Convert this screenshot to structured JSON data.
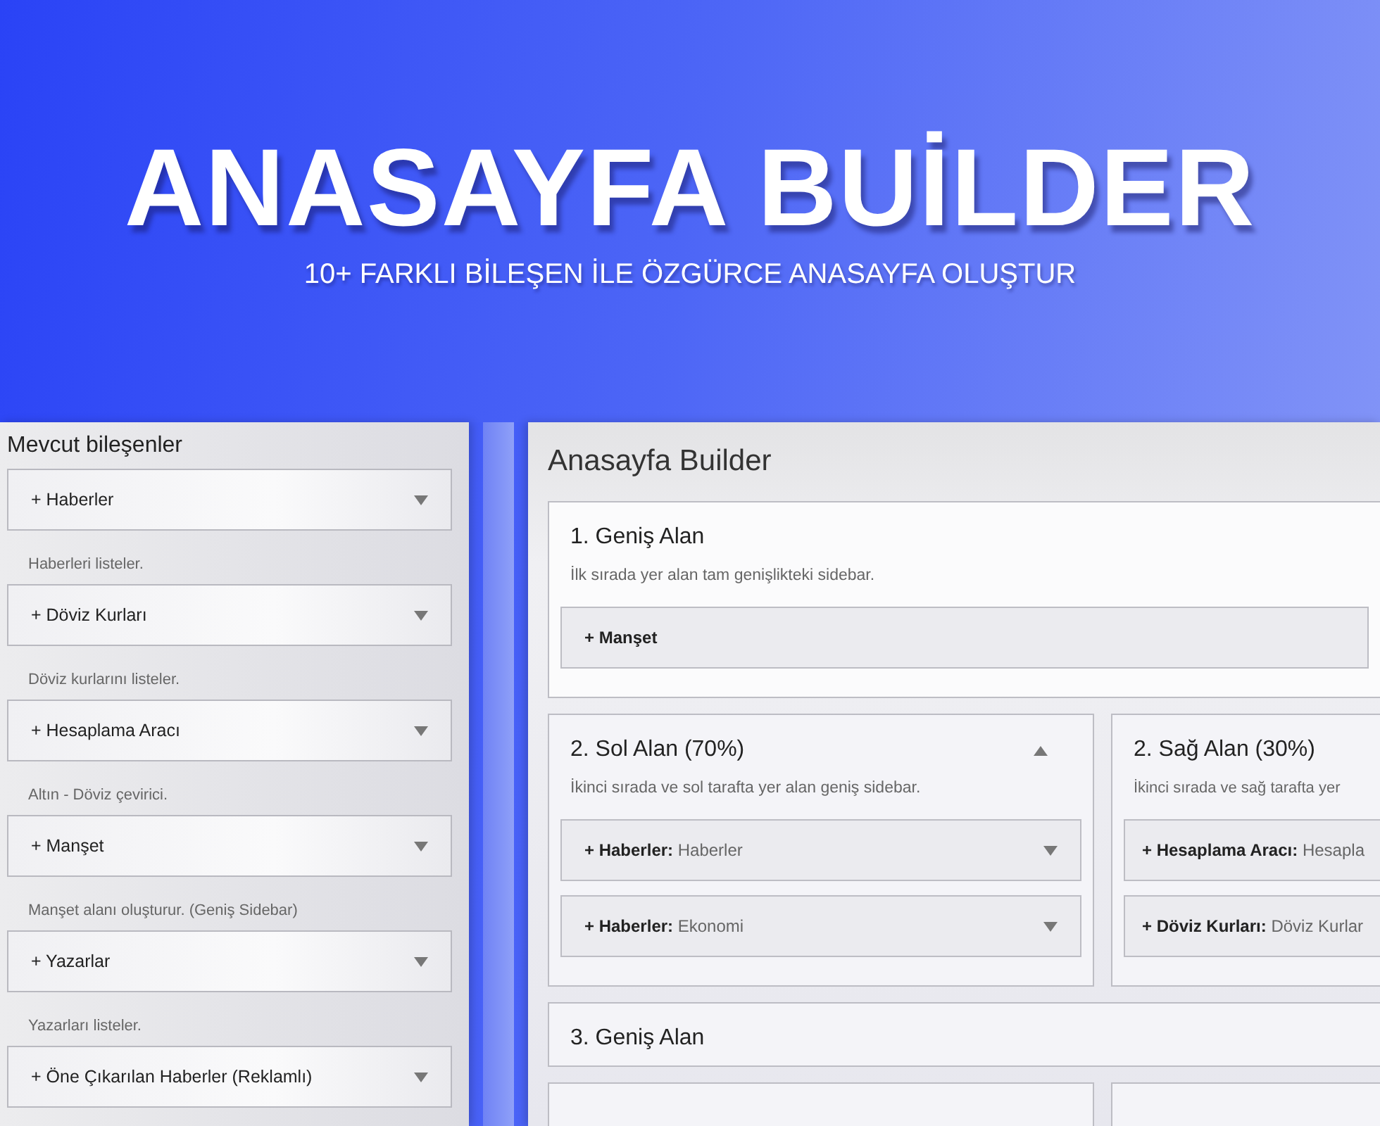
{
  "banner": {
    "title": "ANASAYFA BUİLDER",
    "subtitle": "10+ FARKLI BİLEŞEN İLE ÖZGÜRCE ANASAYFA OLUŞTUR"
  },
  "components": {
    "title": "Mevcut bileşenler",
    "items": [
      {
        "icon": "+",
        "label": "Haberler",
        "expanded": false,
        "description": "Haberleri listeler."
      },
      {
        "icon": "+",
        "label": "Döviz Kurları",
        "expanded": false,
        "description": "Döviz kurlarını listeler."
      },
      {
        "icon": "+",
        "label": "Hesaplama Aracı",
        "expanded": false,
        "description": "Altın - Döviz çevirici."
      },
      {
        "icon": "+",
        "label": "Manşet",
        "expanded": false,
        "description": "Manşet alanı oluşturur. (Geniş Sidebar)"
      },
      {
        "icon": "+",
        "label": "Yazarlar",
        "expanded": false,
        "description": "Yazarları listeler."
      },
      {
        "icon": "+",
        "label": "Öne Çıkarılan Haberler (Reklamlı)",
        "expanded": false
      }
    ]
  },
  "builder": {
    "title": "Anasayfa Builder",
    "sections": [
      {
        "kind": "wide",
        "title": "1. Geniş Alan",
        "description": "İlk sırada yer alan tam genişlikteki sidebar.",
        "items": [
          {
            "icon": "+",
            "label": "Manşet"
          }
        ]
      },
      {
        "kind": "row",
        "columns": [
          {
            "title": "2. Sol Alan (70%)",
            "expanded": true,
            "description": "İkinci sırada ve sol tarafta yer alan geniş sidebar.",
            "items": [
              {
                "icon": "+",
                "label": "Haberler:",
                "value": "Haberler",
                "expanded": false
              },
              {
                "icon": "+",
                "label": "Haberler:",
                "value": "Ekonomi",
                "expanded": false
              }
            ]
          },
          {
            "title": "2. Sağ Alan (30%)",
            "description": "İkinci sırada ve sağ tarafta yer",
            "items": [
              {
                "icon": "+",
                "label": "Hesaplama Aracı:",
                "value": "Hesapla"
              },
              {
                "icon": "+",
                "label": "Döviz Kurları:",
                "value": "Döviz Kurlar"
              }
            ]
          }
        ]
      },
      {
        "kind": "wide",
        "title": "3. Geniş Alan"
      },
      {
        "kind": "row",
        "columns": [
          {},
          {}
        ]
      }
    ]
  }
}
